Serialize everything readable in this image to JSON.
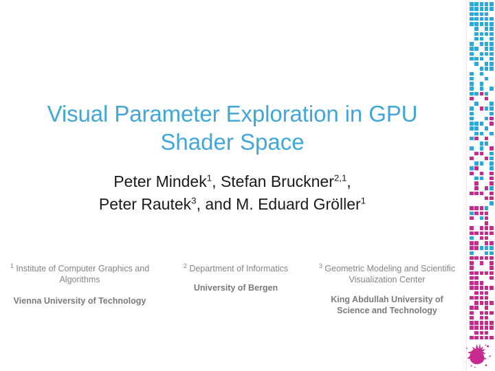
{
  "slide": {
    "title": "Visual Parameter Exploration in GPU Shader Space",
    "title_line1": "Visual Parameter Exploration in GPU",
    "title_line2": "Shader Space"
  },
  "authors": {
    "line1_plain": "Peter Mindek1, Stefan Bruckner2,1,",
    "line2_plain": "Peter Rautek3, and M. Eduard Gröller1",
    "line1": {
      "a1_name": "Peter Mindek",
      "a1_sup": "1",
      "sep1": ", ",
      "a2_name": "Stefan Bruckner",
      "a2_sup": "2,1",
      "sep2": ","
    },
    "line2": {
      "a3_name": "Peter Rautek",
      "a3_sup": "3",
      "sep3": ", and ",
      "a4_name": "M. Eduard Gröller",
      "a4_sup": "1"
    }
  },
  "affiliations": [
    {
      "marker": "1",
      "department": " Institute of Computer Graphics and Algorithms",
      "university": "Vienna University of Technology"
    },
    {
      "marker": "2",
      "department": " Department of Informatics",
      "university": "University of Bergen"
    },
    {
      "marker": "3",
      "department": " Geometric Modeling and Scientific Visualization Center",
      "university": "King Abdullah University of Science and Technology"
    }
  ],
  "decoration": {
    "name": "pixel-gradient-strip",
    "columns": 5,
    "rows": 68,
    "cyan": "#29a8dd",
    "magenta": "#c62a8e",
    "rule_color": "#f2e6f0",
    "splatter_color": "#c62a8e",
    "splatter_name": "ink-splatter"
  },
  "colors": {
    "title": "#41a6d9",
    "author_text": "#1a1a1a",
    "affiliation_text": "#848484",
    "affiliation_bold": "#7a7a7a",
    "background": "#ffffff"
  }
}
